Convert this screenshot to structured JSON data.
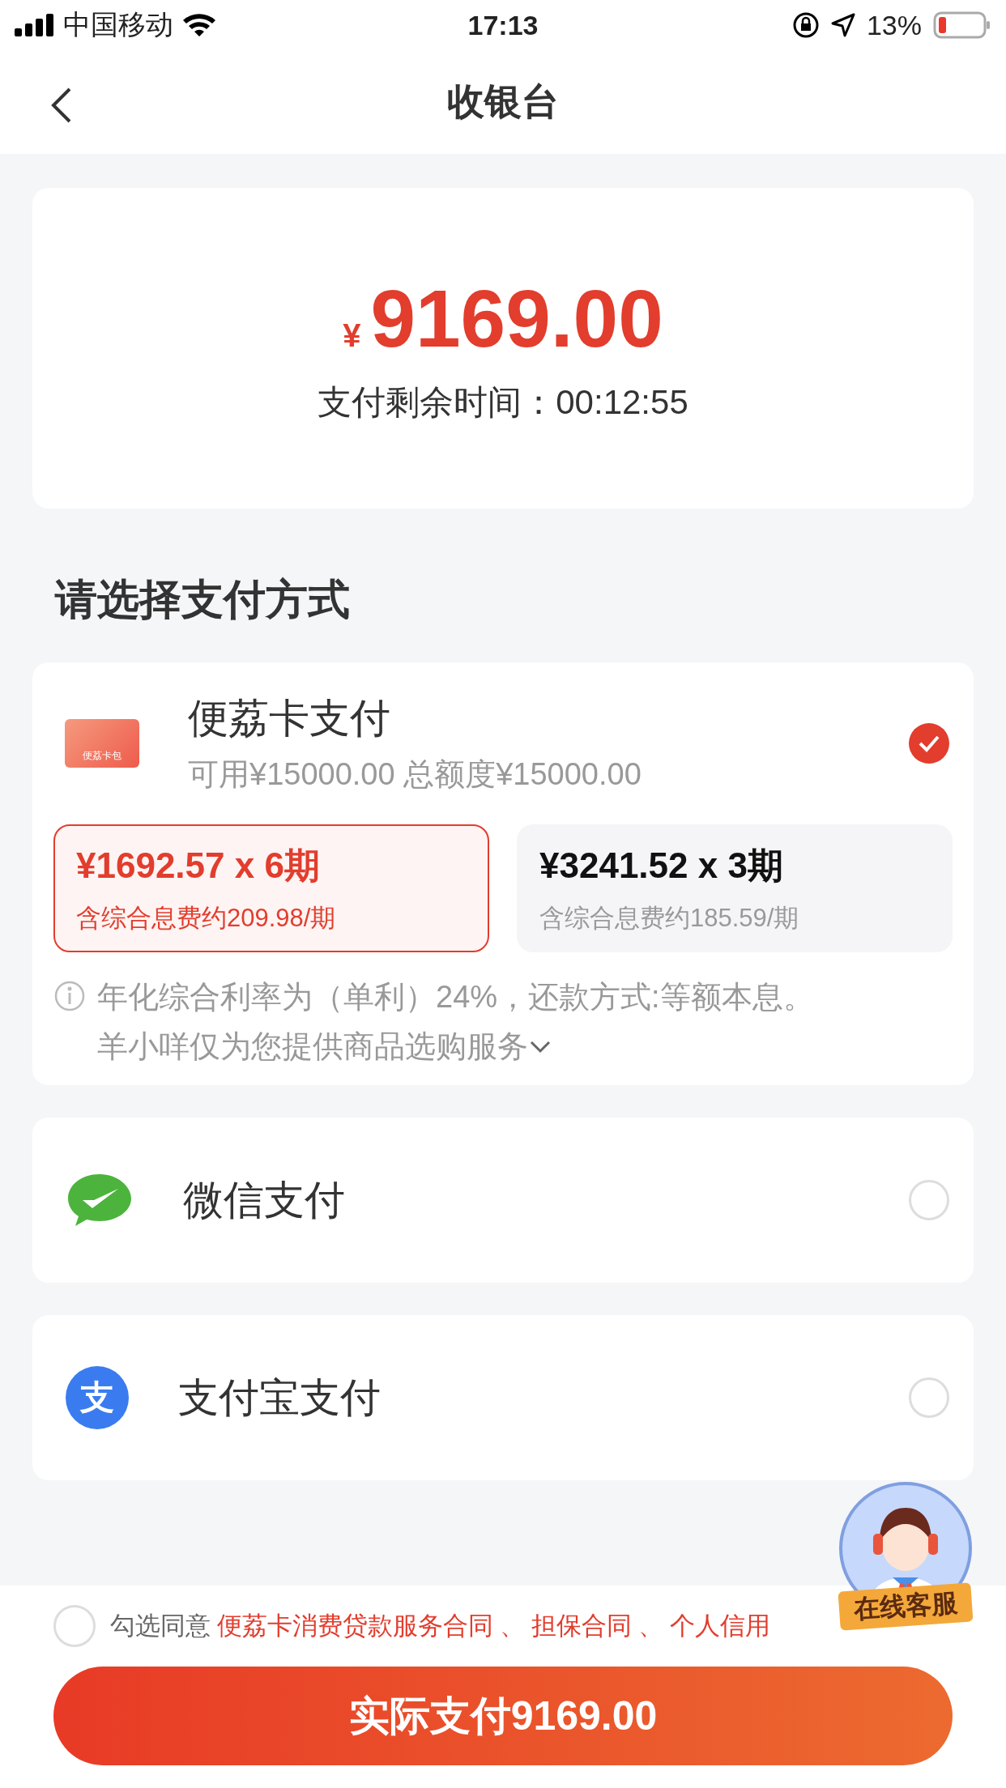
{
  "status_bar": {
    "carrier": "中国移动",
    "time": "17:13",
    "battery": "13%"
  },
  "nav": {
    "title": "收银台"
  },
  "amount": {
    "currency": "¥",
    "value": "9169.00",
    "countdown": "支付剩余时间：00:12:55"
  },
  "section_title": "请选择支付方式",
  "methods": [
    {
      "kind": "card",
      "name": "便荔卡支付",
      "icon_text": "便荔卡包",
      "subtitle": "可用¥15000.00 总额度¥15000.00",
      "selected": true,
      "plans": [
        {
          "amount": "¥1692.57 x 6期",
          "fee": "含综合息费约209.98/期",
          "selected": true
        },
        {
          "amount": "¥3241.52 x 3期",
          "fee": "含综合息费约185.59/期",
          "selected": false
        }
      ],
      "note": [
        "年化综合利率为（单利）24%，还款方式:等额本息。",
        "羊小咩仅为您提供商品选购服务"
      ]
    },
    {
      "kind": "wechat",
      "name": "微信支付",
      "selected": false
    },
    {
      "kind": "alipay",
      "name": "支付宝支付",
      "icon_text": "支",
      "selected": false
    }
  ],
  "agreement": {
    "checked": false,
    "label": "勾选同意",
    "links": [
      "便荔卡消费贷款服务合同",
      "担保合同",
      "个人信用"
    ],
    "separator": "、"
  },
  "pay_button": "实际支付9169.00",
  "service_badge": "在线客服"
}
